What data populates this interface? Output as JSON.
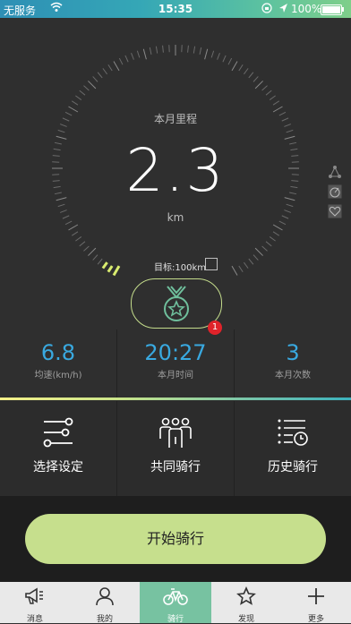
{
  "status_bar": {
    "carrier": "无服务",
    "time": "15:35",
    "battery": "100%"
  },
  "hero": {
    "title": "本月里程",
    "distance": "2.3",
    "unit": "km",
    "goal": "目标:100km",
    "goal_progress": 0.023,
    "badge_count": "1"
  },
  "stats": [
    {
      "value": "6.8",
      "label": "均速(km/h)"
    },
    {
      "value": "20:27",
      "label": "本月时间"
    },
    {
      "value": "3",
      "label": "本月次数"
    }
  ],
  "actions": [
    {
      "label": "选择设定",
      "icon": "sliders-icon"
    },
    {
      "label": "共同骑行",
      "icon": "group-icon"
    },
    {
      "label": "历史骑行",
      "icon": "history-list-icon"
    }
  ],
  "start_button": "开始骑行",
  "tabs": [
    {
      "label": "消息",
      "icon": "megaphone-icon",
      "active": false
    },
    {
      "label": "我的",
      "icon": "person-icon",
      "active": false
    },
    {
      "label": "骑行",
      "icon": "bicycle-icon",
      "active": true
    },
    {
      "label": "发现",
      "icon": "star-icon",
      "active": false
    },
    {
      "label": "更多",
      "icon": "plus-icon",
      "active": false
    }
  ],
  "colors": {
    "accent_blue": "#39a9e0",
    "accent_green": "#c6df8d",
    "tab_active": "#77c2a1",
    "badge_red": "#e0232a"
  }
}
